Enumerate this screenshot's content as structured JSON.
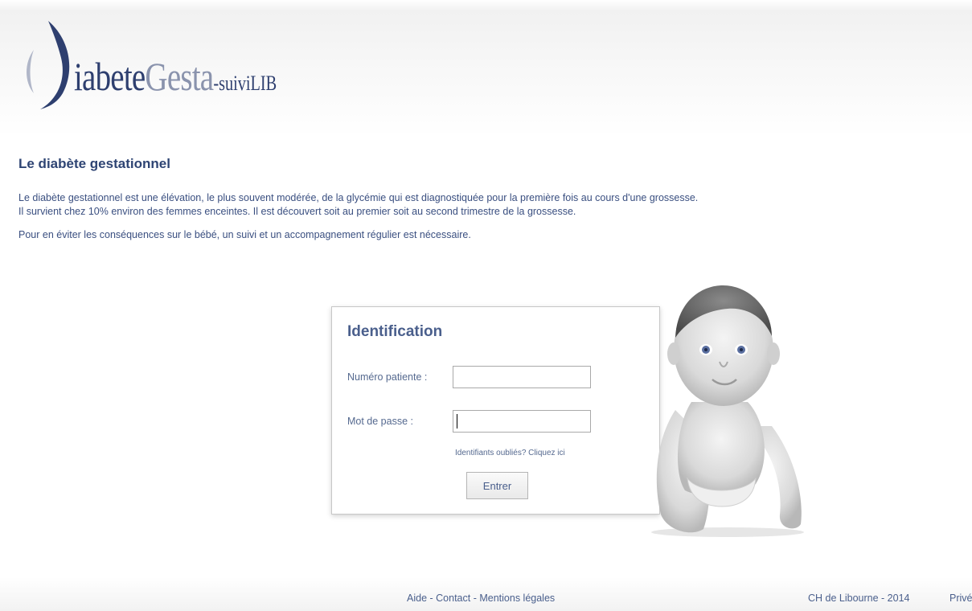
{
  "header": {
    "logo": {
      "main": "iabete",
      "accent": "Gesta",
      "suffix": "-suiviLIB"
    }
  },
  "main": {
    "title": "Le diabète gestationnel",
    "paragraphs": [
      "Le diabète gestationnel est une élévation, le plus souvent modérée, de la glycémie qui est diagnostiquée pour la première fois au cours d'une grossesse.",
      "Il survient chez 10% environ des femmes enceintes. Il est découvert soit au premier soit au second trimestre de la grossesse.",
      "Pour en éviter les conséquences sur le bébé, un suivi et un accompagnement régulier est nécessaire."
    ]
  },
  "login": {
    "title": "Identification",
    "patient_label": "Numéro patiente :",
    "patient_value": "",
    "password_label": "Mot de passe :",
    "password_value": "",
    "forgot_link": "Identifiants oubliés? Cliquez ici",
    "submit_label": "Entrer"
  },
  "footer": {
    "help": "Aide",
    "contact": "Contact",
    "legal": "Mentions légales",
    "separator": " - ",
    "copyright": "CH de Libourne - 2014",
    "private": "Privé"
  },
  "colors": {
    "brand_dark": "#2e3f6f",
    "brand_light": "#8a93ad",
    "text": "#3a4f80",
    "title": "#2e4473"
  }
}
